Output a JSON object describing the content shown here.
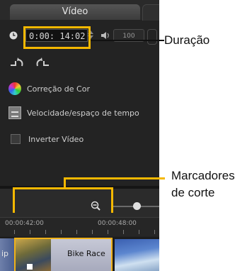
{
  "tab": {
    "label": "Vídeo"
  },
  "duration": {
    "timecode": "0:00: 14:02",
    "volume": "100"
  },
  "options": [
    {
      "label": "Correção de Cor",
      "icon": "color-wheel-icon"
    },
    {
      "label": "Velocidade/espaço de tempo",
      "icon": "speed-icon"
    },
    {
      "label": "Inverter Vídeo",
      "icon": "checkbox"
    }
  ],
  "ruler": {
    "labels": [
      "00:00:42:00",
      "00:00:48:00"
    ]
  },
  "clips": {
    "left_label": "ip",
    "main_label": "Bike Race"
  },
  "callouts": {
    "duration": "Duração",
    "markers_line1": "Marcadores",
    "markers_line2": "de corte"
  },
  "colors": {
    "accent": "#f5b800",
    "panel": "#232323"
  }
}
